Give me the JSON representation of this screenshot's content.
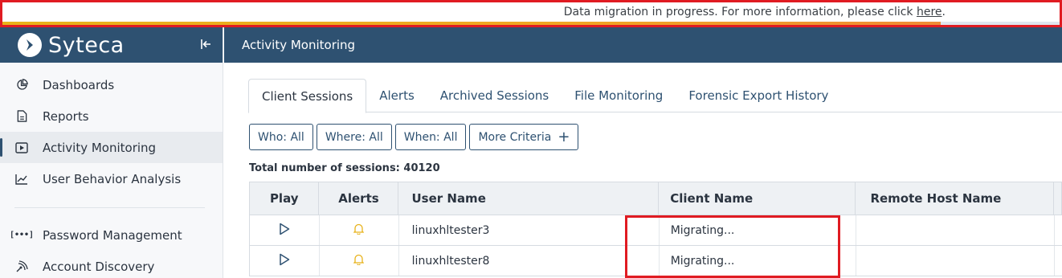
{
  "banner": {
    "text": "Data migration in progress. For more information, please click ",
    "link": "here",
    "suffix": "."
  },
  "app": {
    "brand": "Syteca",
    "collapse_icon": "collapse-left-icon"
  },
  "sidebar": {
    "items": [
      {
        "label": "Dashboards",
        "icon": "dashboard-pie-icon"
      },
      {
        "label": "Reports",
        "icon": "document-icon"
      },
      {
        "label": "Activity Monitoring",
        "icon": "play-screen-icon",
        "active": true
      },
      {
        "label": "User Behavior Analysis",
        "icon": "trend-chart-icon"
      },
      {
        "label": "Password Management",
        "icon": "password-dots-icon"
      },
      {
        "label": "Account Discovery",
        "icon": "radar-icon"
      }
    ]
  },
  "header": {
    "title": "Activity Monitoring"
  },
  "tabs": [
    {
      "label": "Client Sessions",
      "active": true
    },
    {
      "label": "Alerts"
    },
    {
      "label": "Archived Sessions"
    },
    {
      "label": "File Monitoring"
    },
    {
      "label": "Forensic Export History"
    }
  ],
  "filters": [
    {
      "label": "Who: All"
    },
    {
      "label": "Where: All"
    },
    {
      "label": "When: All"
    },
    {
      "label": "More Criteria"
    }
  ],
  "total": {
    "text": "Total number of sessions: 40120"
  },
  "table": {
    "columns": [
      "Play",
      "Alerts",
      "User Name",
      "Client Name",
      "Remote Host Name"
    ],
    "rows": [
      {
        "user": "linuxhltester3",
        "client": "Migrating...",
        "remote": ""
      },
      {
        "user": "linuxhltester8",
        "client": "Migrating...",
        "remote": ""
      }
    ]
  },
  "colors": {
    "brand": "#2e5171",
    "highlight": "#e01b22",
    "alert": "#e8b21a",
    "progress": "#f0a623"
  }
}
